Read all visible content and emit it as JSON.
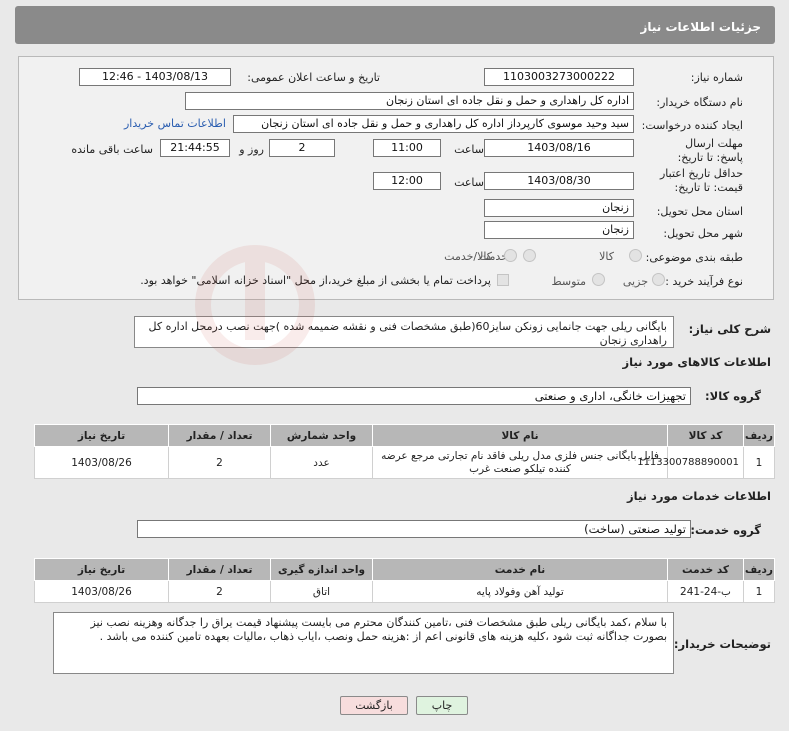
{
  "header": {
    "title": "جزئیات اطلاعات نیاز"
  },
  "need_number": {
    "label": "شماره نیاز:",
    "value": "1103003273000222"
  },
  "announce": {
    "label": "تاریخ و ساعت اعلان عمومی:",
    "value": "1403/08/13 - 12:46"
  },
  "buyer_org": {
    "label": "نام دستگاه خریدار:",
    "value": "اداره کل راهداری و حمل و نقل جاده ای استان زنجان"
  },
  "requester": {
    "label": "ایجاد کننده درخواست:",
    "value": "سید وحید موسوی کارپرداز اداره کل راهداری و حمل و نقل جاده ای استان زنجان",
    "contact_link": "اطلاعات تماس خریدار"
  },
  "deadline": {
    "label": "مهلت ارسال پاسخ: تا تاریخ:",
    "date": "1403/08/16",
    "time_label": "ساعت",
    "time": "11:00",
    "days": "2",
    "days_label": "روز و",
    "remaining": "21:44:55",
    "remaining_label": "ساعت باقی مانده"
  },
  "validity": {
    "label": "حداقل تاریخ اعتبار قیمت: تا تاریخ:",
    "date": "1403/08/30",
    "time_label": "ساعت",
    "time": "12:00"
  },
  "province": {
    "label": "استان محل تحویل:",
    "value": "زنجان"
  },
  "city": {
    "label": "شهر محل تحویل:",
    "value": "زنجان"
  },
  "category": {
    "label": "طبقه بندی موضوعی:",
    "options": [
      "کالا",
      "خدمت",
      "کالا/خدمت"
    ]
  },
  "process": {
    "label": "نوع فرآیند خرید :",
    "options": [
      "جزیی",
      "متوسط"
    ],
    "payment_note": "پرداخت تمام یا بخشی از مبلغ خرید،از محل \"اسناد خزانه اسلامی\" خواهد بود."
  },
  "summary": {
    "label": "شرح کلی نیاز:",
    "value": "بایگانی ریلی جهت جانمایی زونکن سایز60(طبق مشخصات فنی و نقشه ضمیمه شده )جهت نصب درمحل اداره کل راهداری زنجان"
  },
  "goods_section": {
    "title": "اطلاعات کالاهای مورد نیاز",
    "group_label": "گروه کالا:",
    "group_value": "تجهیزات خانگی، اداری و صنعتی",
    "columns": [
      "ردیف",
      "کد کالا",
      "نام کالا",
      "واحد شمارش",
      "تعداد / مقدار",
      "تاریخ نیاز"
    ],
    "rows": [
      {
        "row": "1",
        "code": "1113300788890001",
        "name": "فایل بایگانی جنس فلزی مدل ریلی فاقد نام تجارتی مرجع عرضه کننده تیلکو صنعت غرب",
        "unit": "عدد",
        "qty": "2",
        "date": "1403/08/26"
      }
    ]
  },
  "services_section": {
    "title": "اطلاعات خدمات مورد نیاز",
    "group_label": "گروه خدمت:",
    "group_value": "تولید صنعتی (ساخت)",
    "columns": [
      "ردیف",
      "کد خدمت",
      "نام خدمت",
      "واحد اندازه گیری",
      "تعداد / مقدار",
      "تاریخ نیاز"
    ],
    "rows": [
      {
        "row": "1",
        "code": "ب-24-241",
        "name": "تولید آهن وفولاد پایه",
        "unit": "اتاق",
        "qty": "2",
        "date": "1403/08/26"
      }
    ]
  },
  "buyer_notes": {
    "label": "توضیحات خریدار:",
    "value": "با سلام ،کمد بایگانی ریلی طبق مشخصات فنی ،تامین کنندگان محترم می بایست پیشنهاد قیمت یراق را جدگانه وهزینه نصب نیز بصورت جداگانه ثبت شود ،کلیه هزینه های قانونی اعم از :هزینه حمل ونصب ،ایاب ذهاب ،مالیات بعهده تامین کننده می باشد ."
  },
  "buttons": {
    "print": "چاپ",
    "back": "بازگشت"
  },
  "colors": {
    "header": "#8a8a8a",
    "table_header": "#b7b7b7",
    "link": "#2a5db0"
  }
}
